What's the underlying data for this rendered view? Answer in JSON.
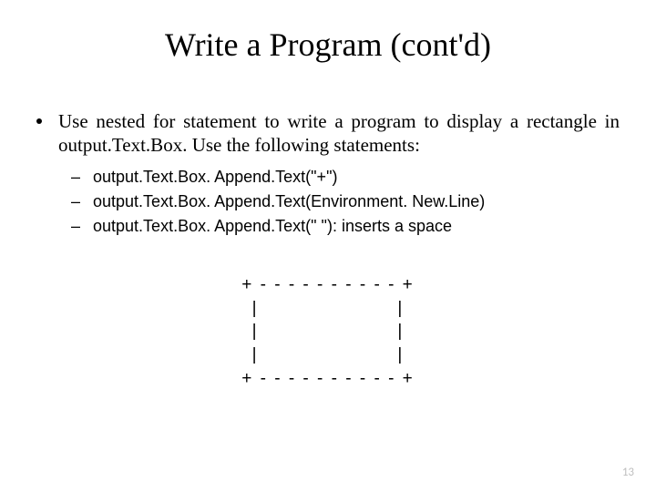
{
  "title": "Write a Program (cont'd)",
  "bullet_main": "Use nested for statement to write a program to display a rectangle in output.Text.Box. Use the following statements:",
  "sub": [
    "output.Text.Box. Append.Text(\"+\")",
    "output.Text.Box. Append.Text(Environment. New.Line)",
    "output.Text.Box. Append.Text(\" \"): inserts a space"
  ],
  "ascii": "+ - - - - - - - - - - +\n|                     |\n|                     |\n|                     |\n+ - - - - - - - - - - +",
  "page_number": "13"
}
